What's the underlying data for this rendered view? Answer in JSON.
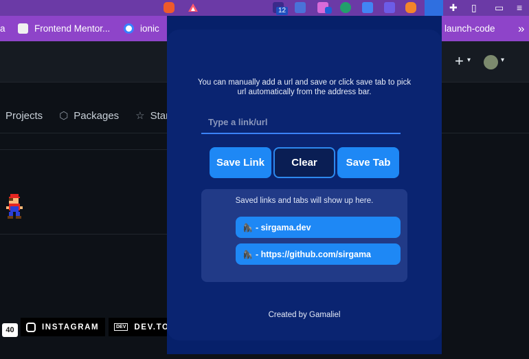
{
  "toolbar": {
    "extension_badge": "12",
    "extensions": [
      "brave-icon",
      "brave-rewards-icon",
      "extension-icon",
      "extension-icon",
      "extension-icon",
      "extension-icon",
      "translate-icon",
      "extension-icon",
      "metamask-icon",
      "link-saver-icon",
      "puzzle-icon",
      "sidebar-icon",
      "wallet-icon",
      "menu-icon"
    ]
  },
  "bookmarks": {
    "items": [
      {
        "label": "a"
      },
      {
        "label": "Frontend Mentor..."
      },
      {
        "label": "ionic"
      },
      {
        "label": "launch-code"
      }
    ],
    "overflow_glyph": "»"
  },
  "github": {
    "header": {
      "plus_glyph": "+",
      "caret_glyph": "▾"
    },
    "nav": [
      {
        "label": "Projects",
        "icon": "table-icon"
      },
      {
        "label": "Packages",
        "icon": "package-icon",
        "glyph": "⬡"
      },
      {
        "label": "Stars",
        "icon": "star-icon",
        "glyph": "☆"
      }
    ],
    "badge": "40",
    "social": [
      {
        "label": "INSTAGRAM",
        "icon": "instagram-icon"
      },
      {
        "label": "DEV.TO",
        "icon": "dev-icon",
        "glyph": "DEV"
      }
    ]
  },
  "popup": {
    "intro": "You can manually add a url and save or click save tab to pick url automatically from the address bar.",
    "input_placeholder": "Type a link/url",
    "input_value": "",
    "buttons": {
      "save_link": "Save Link",
      "clear": "Clear",
      "save_tab": "Save Tab"
    },
    "saved_hint": "Saved links and tabs will show up here.",
    "saved_items": [
      {
        "icon": "gorilla-icon",
        "glyph": "🦍",
        "text": "- sirgama.dev"
      },
      {
        "icon": "gorilla-icon",
        "glyph": "🦍",
        "text": "- https://github.com/sirgama"
      }
    ],
    "credit": "Created by Gamaliel"
  },
  "colors": {
    "tab_strip": "#6b3aa6",
    "bookmarks_bar": "#8e44c9",
    "popup_bg": "#0a2471",
    "button_blue": "#1e88f5",
    "panel_bg": "#213a87",
    "page_bg": "#0d1117"
  }
}
